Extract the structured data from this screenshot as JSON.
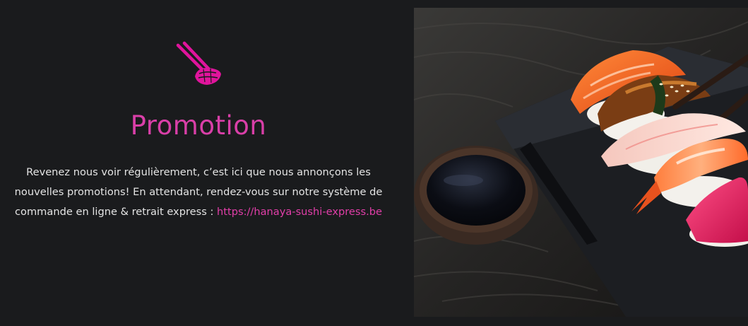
{
  "promo": {
    "title": "Promotion",
    "text": "Revenez nous voir régulièrement, c’est ici que nous annonçons les nouvelles promotions! En attendant, rendez-vous sur notre système de commande en ligne & retrait express : ",
    "link_text": "https://hanaya-sushi-express.be"
  },
  "logo": {
    "icon": "chopsticks-sushi-icon",
    "color": "#e0149c"
  },
  "photo": {
    "subject": "sushi-photo"
  },
  "colors": {
    "background": "#1a1b1d",
    "accent": "#d93fa8",
    "text": "#e4e4e4"
  }
}
